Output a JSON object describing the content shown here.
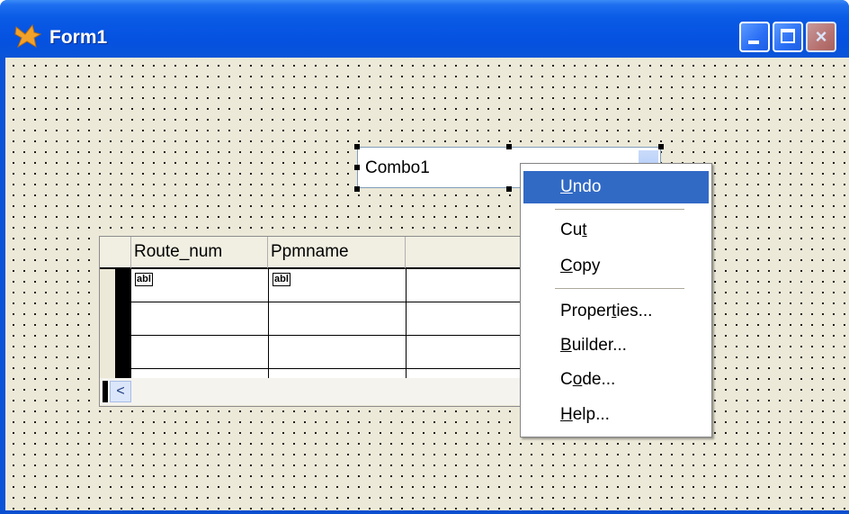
{
  "window": {
    "title": "Form1"
  },
  "titlebar": {
    "buttons": [
      "minimize",
      "maximize",
      "close"
    ],
    "close_symbol": "×"
  },
  "combo": {
    "value": "Combo1"
  },
  "grid": {
    "columns": [
      "Route_num",
      "Ppmname"
    ],
    "cell_control_label": "abl",
    "scroll_left_symbol": "<"
  },
  "context_menu": {
    "items": [
      {
        "label": "Undo",
        "mnemonic_index": 0,
        "highlighted": true
      },
      {
        "label": "Cut",
        "mnemonic_index": 2
      },
      {
        "label": "Copy",
        "mnemonic_index": 0
      },
      {
        "label": "Properties...",
        "mnemonic_index": 6
      },
      {
        "label": "Builder...",
        "mnemonic_index": 0
      },
      {
        "label": "Code...",
        "mnemonic_index": 1
      },
      {
        "label": "Help...",
        "mnemonic_index": 0
      }
    ]
  },
  "colors": {
    "titlebar": "#0a5be6",
    "menu_highlight": "#316ac5",
    "form_background": "#ece9d8"
  }
}
